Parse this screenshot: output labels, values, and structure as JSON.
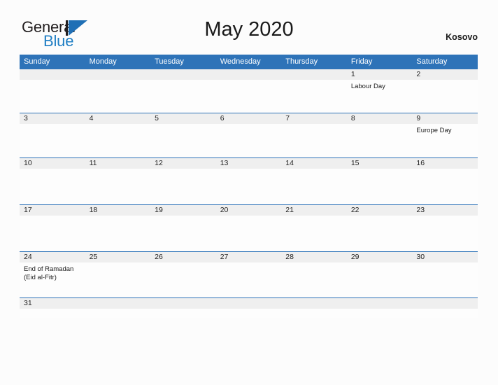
{
  "brand": {
    "name_part1": "General",
    "name_part2": "Blue",
    "mark_icon": "triangle-logo-icon",
    "accent_color": "#1f7ec4",
    "dark_color": "#231f20"
  },
  "header": {
    "title": "May 2020",
    "country": "Kosovo"
  },
  "theme": {
    "header_blue": "#2e73b8",
    "day_band_gray": "#efefef",
    "page_background": "#fcfcfc"
  },
  "calendar": {
    "weekday_headers": [
      "Sunday",
      "Monday",
      "Tuesday",
      "Wednesday",
      "Thursday",
      "Friday",
      "Saturday"
    ],
    "weeks": [
      {
        "days": [
          {
            "num": "",
            "events": []
          },
          {
            "num": "",
            "events": []
          },
          {
            "num": "",
            "events": []
          },
          {
            "num": "",
            "events": []
          },
          {
            "num": "",
            "events": []
          },
          {
            "num": "1",
            "events": [
              "Labour Day"
            ]
          },
          {
            "num": "2",
            "events": []
          }
        ]
      },
      {
        "days": [
          {
            "num": "3",
            "events": []
          },
          {
            "num": "4",
            "events": []
          },
          {
            "num": "5",
            "events": []
          },
          {
            "num": "6",
            "events": []
          },
          {
            "num": "7",
            "events": []
          },
          {
            "num": "8",
            "events": []
          },
          {
            "num": "9",
            "events": [
              "Europe Day"
            ]
          }
        ]
      },
      {
        "days": [
          {
            "num": "10",
            "events": []
          },
          {
            "num": "11",
            "events": []
          },
          {
            "num": "12",
            "events": []
          },
          {
            "num": "13",
            "events": []
          },
          {
            "num": "14",
            "events": []
          },
          {
            "num": "15",
            "events": []
          },
          {
            "num": "16",
            "events": []
          }
        ]
      },
      {
        "days": [
          {
            "num": "17",
            "events": []
          },
          {
            "num": "18",
            "events": []
          },
          {
            "num": "19",
            "events": []
          },
          {
            "num": "20",
            "events": []
          },
          {
            "num": "21",
            "events": []
          },
          {
            "num": "22",
            "events": []
          },
          {
            "num": "23",
            "events": []
          }
        ]
      },
      {
        "days": [
          {
            "num": "24",
            "events": [
              "End of Ramadan",
              "(Eid al-Fitr)"
            ]
          },
          {
            "num": "25",
            "events": []
          },
          {
            "num": "26",
            "events": []
          },
          {
            "num": "27",
            "events": []
          },
          {
            "num": "28",
            "events": []
          },
          {
            "num": "29",
            "events": []
          },
          {
            "num": "30",
            "events": []
          }
        ]
      },
      {
        "days": [
          {
            "num": "31",
            "events": []
          },
          {
            "num": "",
            "events": []
          },
          {
            "num": "",
            "events": []
          },
          {
            "num": "",
            "events": []
          },
          {
            "num": "",
            "events": []
          },
          {
            "num": "",
            "events": []
          },
          {
            "num": "",
            "events": []
          }
        ]
      }
    ]
  }
}
